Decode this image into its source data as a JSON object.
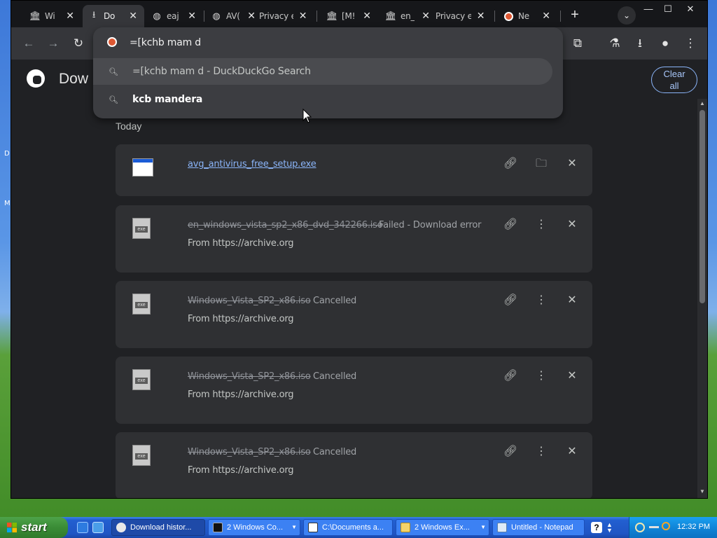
{
  "desktop": {
    "glyph_1": "D",
    "glyph_2": "M"
  },
  "window_controls": {
    "minimize": "—",
    "maximize": "☐",
    "close": "✕"
  },
  "tabs": [
    {
      "title": "Wi",
      "icon": "bank-icon"
    },
    {
      "title": "Do",
      "icon": "download-icon",
      "active": true
    },
    {
      "title": "eaj",
      "icon": "globe-icon"
    },
    {
      "title": "AV(",
      "icon": "globe-icon"
    },
    {
      "title": "Privacy err",
      "icon": "none"
    },
    {
      "title": "[M!",
      "icon": "bank-icon"
    },
    {
      "title": "en_",
      "icon": "bank-icon"
    },
    {
      "title": "Privacy err",
      "icon": "none"
    },
    {
      "title": "Ne",
      "icon": "duckduckgo-icon"
    }
  ],
  "omnibox": {
    "text": "=[kchb mam d",
    "suggestions": [
      {
        "text": "=[kchb mam d - DuckDuckGo Search",
        "bold": false
      },
      {
        "text": "kcb mandera",
        "bold": true
      }
    ]
  },
  "page": {
    "title": "Dow",
    "clear_all_line1": "Clear",
    "clear_all_line2": "all",
    "section": "Today"
  },
  "downloads": [
    {
      "name": "avg_antivirus_free_setup.exe",
      "status": "",
      "source": "",
      "state": "complete"
    },
    {
      "name": "en_windows_vista_sp2_x86_dvd_342266.iso",
      "status": "Failed - Download error",
      "source": "From https://archive.org",
      "state": "failed"
    },
    {
      "name": "Windows_Vista_SP2_x86.iso",
      "status": "Cancelled",
      "source": "From https://archive.org",
      "state": "cancelled"
    },
    {
      "name": "Windows_Vista_SP2_x86.iso",
      "status": "Cancelled",
      "source": "From https://archive.org",
      "state": "cancelled"
    },
    {
      "name": "Windows_Vista_SP2_x86.iso",
      "status": "Cancelled",
      "source": "From https://archive.org",
      "state": "cancelled"
    }
  ],
  "taskbar": {
    "start": "start",
    "items": [
      {
        "label": "Download histor...",
        "icon": "chrome-icon",
        "active": true
      },
      {
        "label": "2 Windows Co...",
        "icon": "cmd-icon",
        "group": true
      },
      {
        "label": "C:\\Documents a...",
        "icon": "7zip-icon"
      },
      {
        "label": "2 Windows Ex...",
        "icon": "folder-icon",
        "group": true
      },
      {
        "label": "Untitled - Notepad",
        "icon": "notepad-icon"
      }
    ],
    "help": "?",
    "clock": "12:32 PM"
  }
}
